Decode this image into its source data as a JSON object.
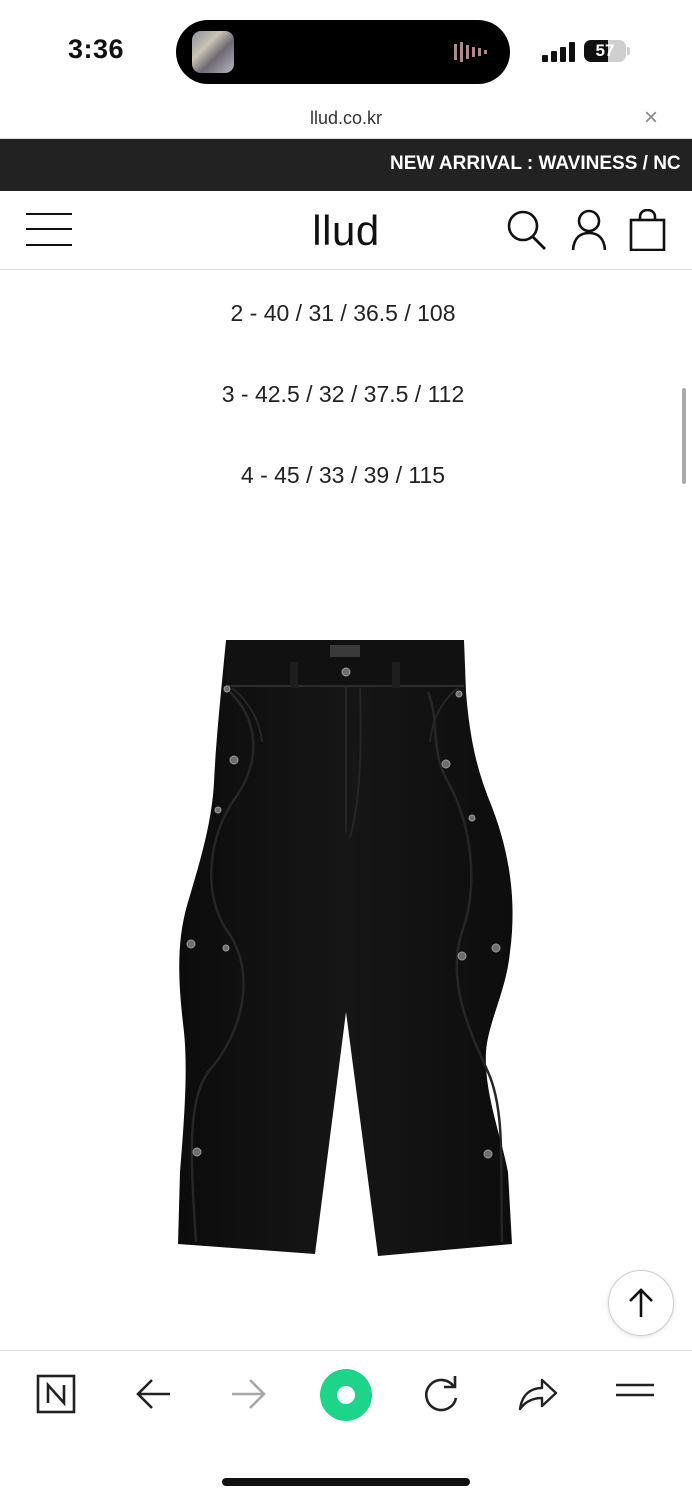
{
  "status_bar": {
    "time": "3:36",
    "battery_percent": "57",
    "battery_level": 0.57
  },
  "browser": {
    "url": "llud.co.kr",
    "close_symbol": "×"
  },
  "announcement": {
    "text": "NEW ARRIVAL : WAVINESS / NC"
  },
  "header": {
    "logo": "llud"
  },
  "content": {
    "size_lines": [
      "2 - 40 / 31 / 36.5 / 108",
      "3 - 42.5 / 32 / 37.5 / 112",
      "4 - 45 / 33 / 39 / 115"
    ]
  },
  "icons": {
    "menu": "hamburger-menu-icon",
    "search": "search-icon",
    "account": "user-icon",
    "cart": "shopping-bag-icon",
    "scroll_top": "arrow-up-icon",
    "naver": "naver-n-icon",
    "back": "arrow-left-icon",
    "forward": "arrow-right-icon",
    "green": "green-circle-icon",
    "reload": "reload-icon",
    "share": "share-icon",
    "more": "more-menu-icon"
  },
  "colors": {
    "announce_bg": "#222222",
    "green_accent": "#1ed48a"
  }
}
